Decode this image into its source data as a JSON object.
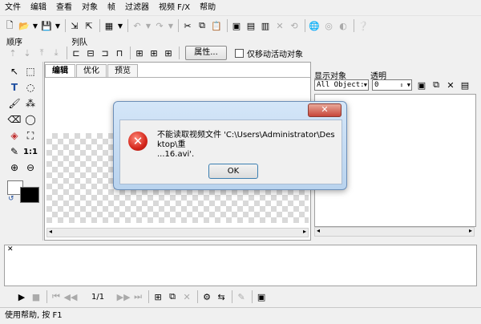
{
  "menu": [
    "文件",
    "编辑",
    "查看",
    "对象",
    "帧",
    "过滤器",
    "视频 F/X",
    "帮助"
  ],
  "toolbar": {
    "labels_order": "顺序",
    "labels_align": "列队",
    "properties_button": "属性...",
    "move_active_only_checkbox": "仅移动活动对象"
  },
  "editor": {
    "tabs": [
      {
        "label": "编辑",
        "active": true
      },
      {
        "label": "优化",
        "active": false
      },
      {
        "label": "预览",
        "active": false
      }
    ]
  },
  "right_panel": {
    "show_objects_label": "显示对象",
    "opacity_label": "透明",
    "objects_select_value": "All Object:",
    "opacity_value": "0"
  },
  "transport": {
    "frame_counter": "1/1"
  },
  "status": {
    "text": "使用帮助, 按 F1"
  },
  "dialog": {
    "close_label": "✕",
    "message_line1": "不能读取视频文件 'C:\\Users\\Administrator\\Desktop\\重",
    "message_line2": "...16.avi'.",
    "ok_label": "OK",
    "error_icon": "error-icon"
  },
  "colors": {
    "foreground_swatch": "#ffffff",
    "background_swatch": "#000000",
    "dialog_frame": "#b9d3ee",
    "close_button": "#c7463a"
  }
}
